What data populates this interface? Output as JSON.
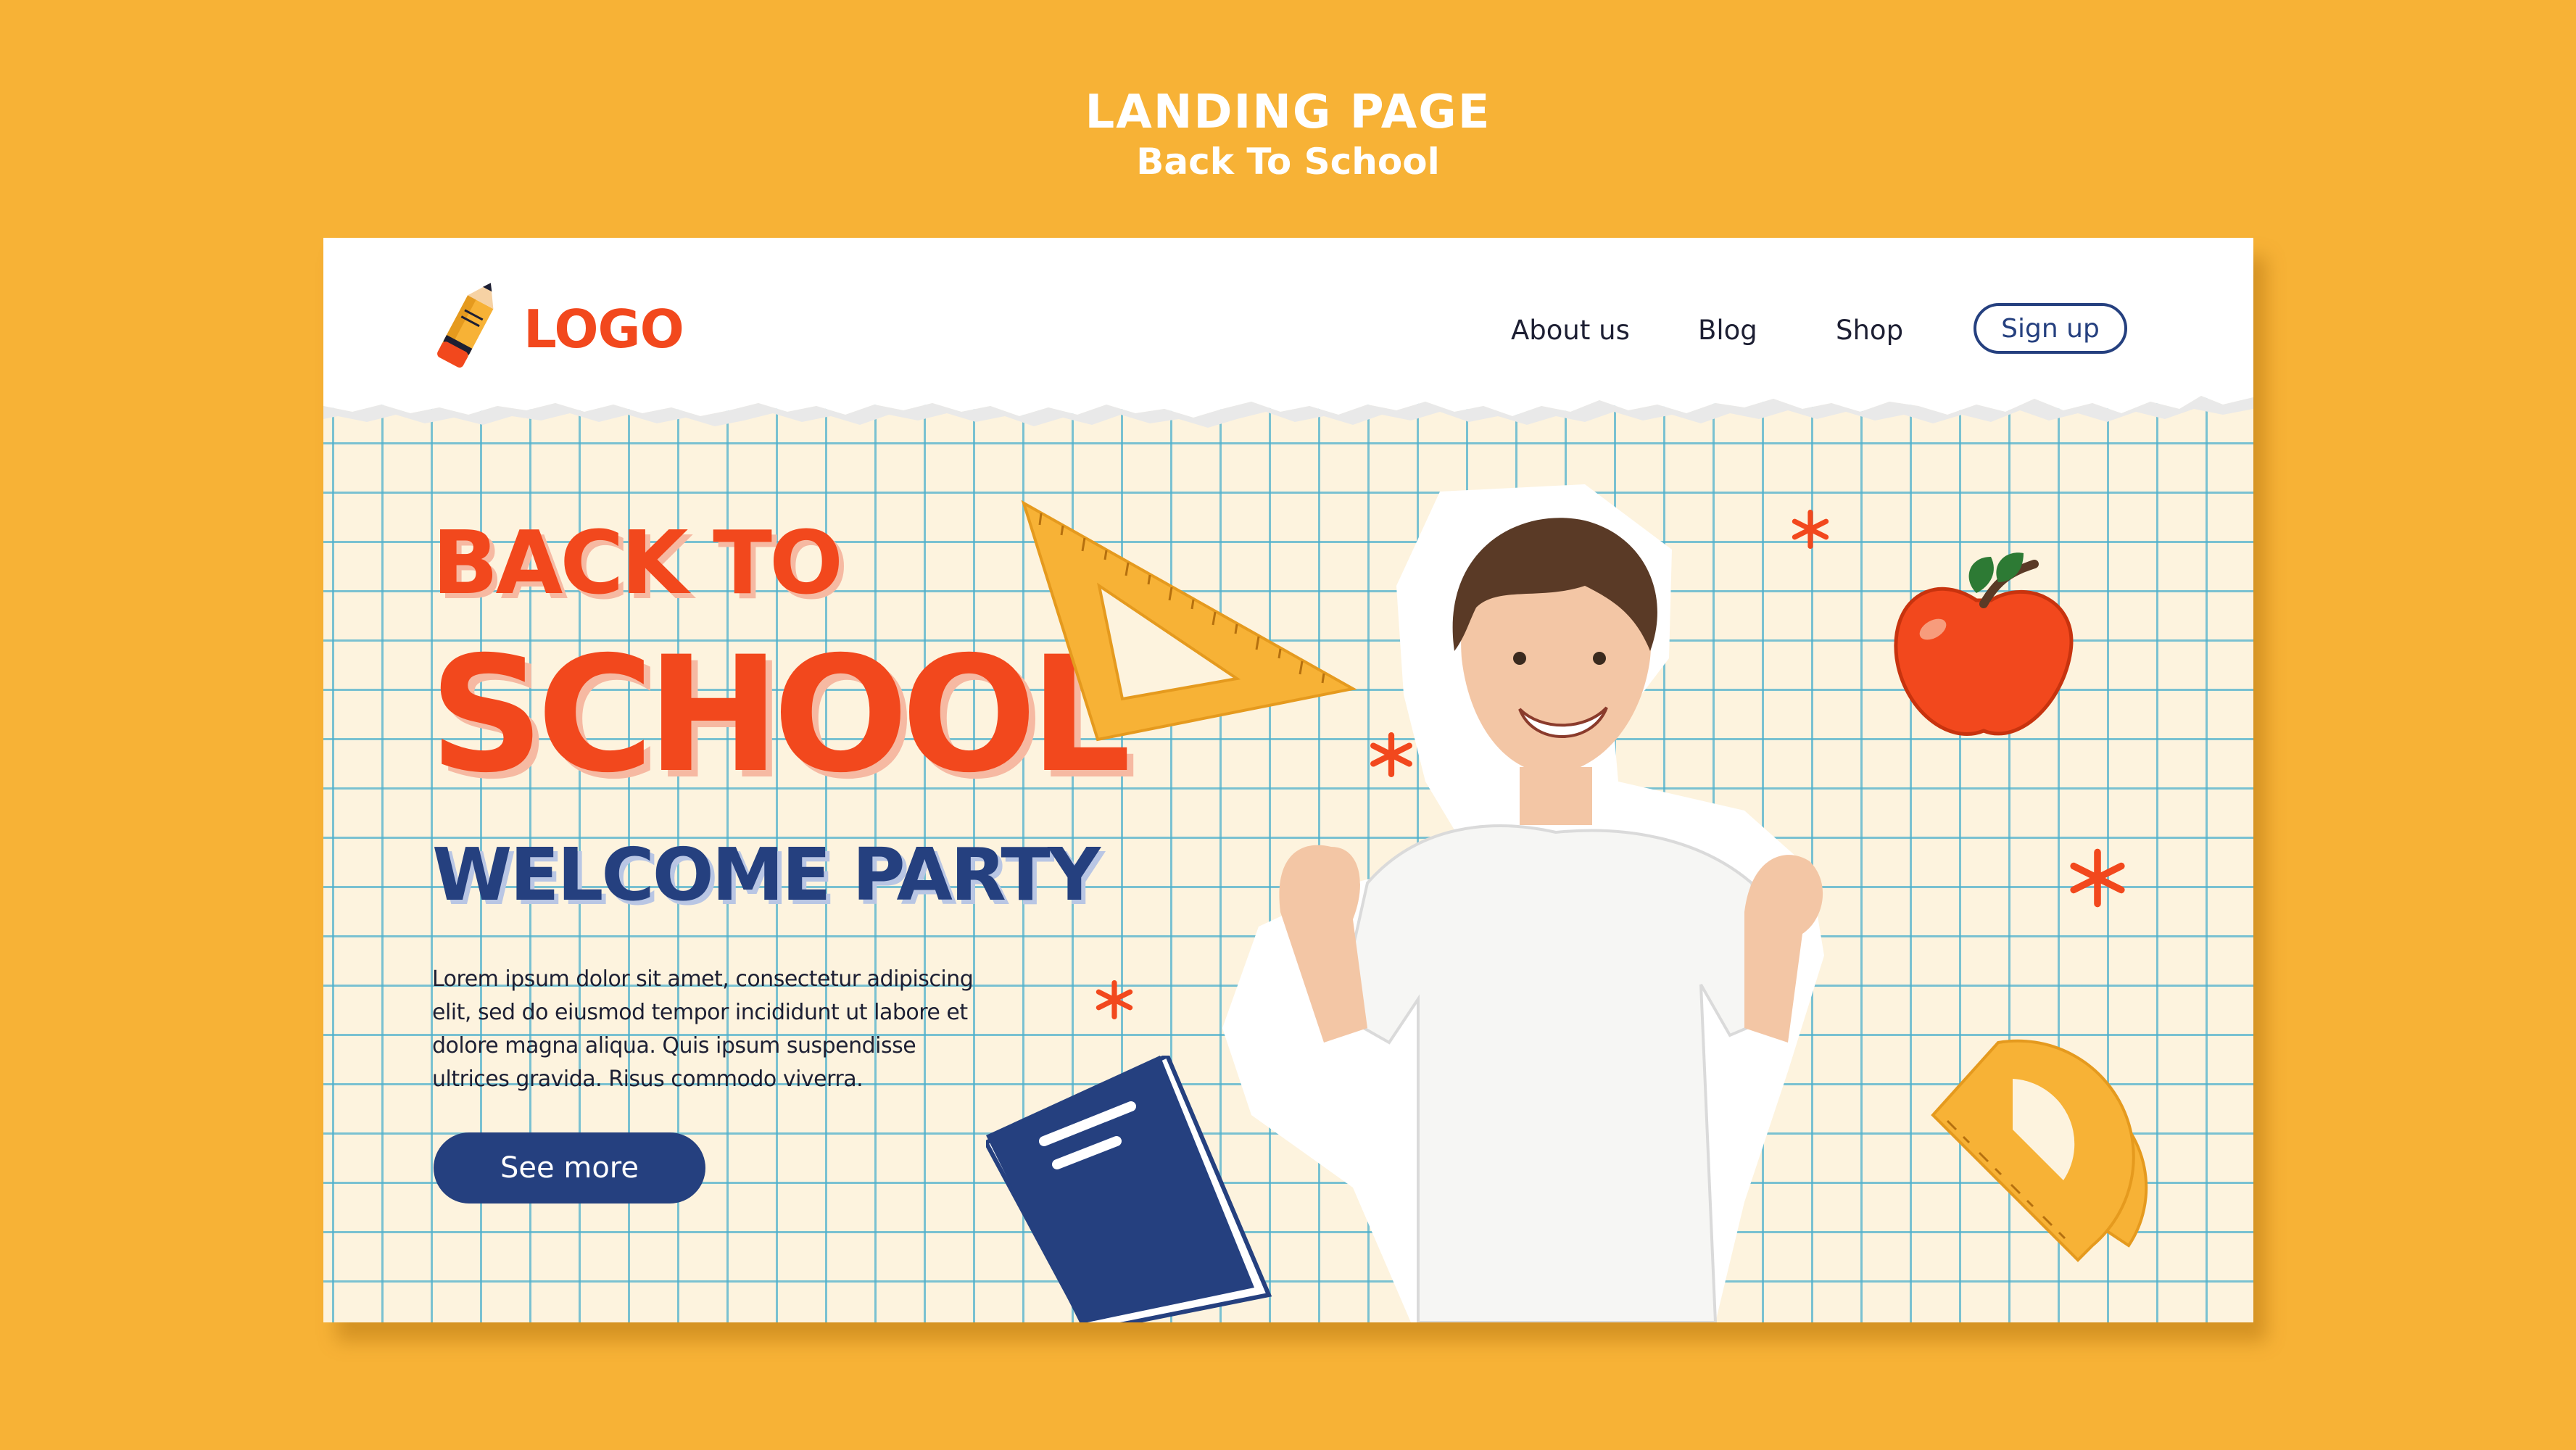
{
  "page_header": {
    "title": "LANDING PAGE",
    "subtitle": "Back To School"
  },
  "nav": {
    "logo_text": "LOGO",
    "links": [
      "About us",
      "Blog",
      "Shop"
    ],
    "signup_label": "Sign up"
  },
  "hero": {
    "line1": "BACK TO",
    "line2": "SCHOOL",
    "line3": "WELCOME PARTY",
    "body": "Lorem ipsum dolor sit amet, consectetur adipiscing elit, sed do eiusmod tempor incididunt ut labore et dolore magna aliqua. Quis ipsum suspendisse ultrices gravida. Risus commodo viverra.",
    "cta_label": "See more"
  },
  "colors": {
    "background": "#F7B236",
    "accent_orange": "#F2481D",
    "navy": "#25407F",
    "paper": "#FDF3DE",
    "grid_line": "#4EB0CC"
  },
  "icons": [
    "pencil-icon",
    "set-square-ruler-icon",
    "apple-icon",
    "notebook-icon",
    "protractor-icon",
    "asterisk-icon"
  ]
}
